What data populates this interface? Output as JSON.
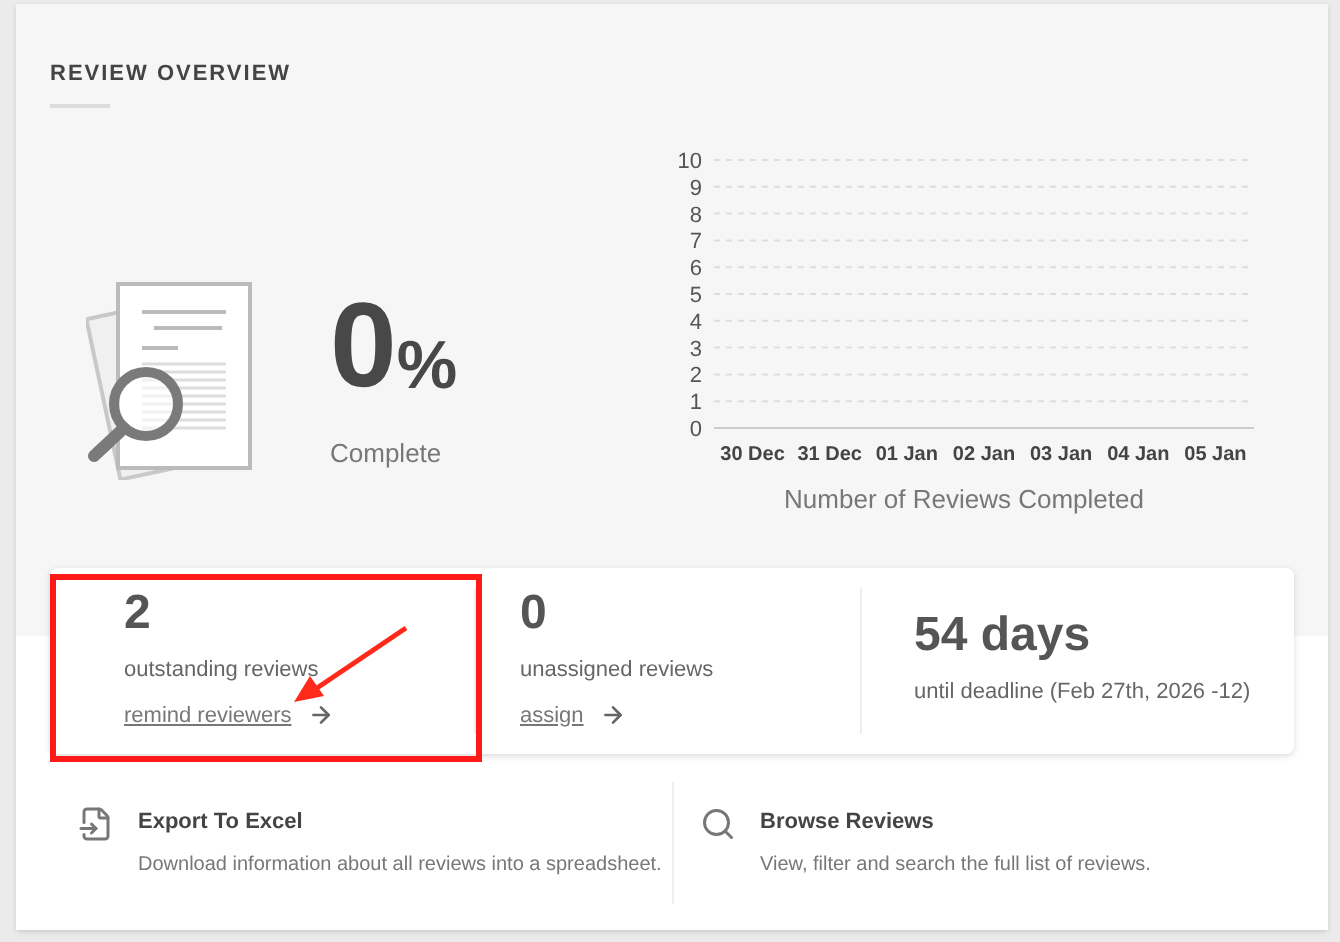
{
  "section_title": "REVIEW OVERVIEW",
  "progress": {
    "value": "0",
    "unit": "%",
    "label": "Complete"
  },
  "chart": {
    "chart_data": {
      "type": "bar",
      "xlabel": "Number of Reviews Completed",
      "categories": [
        "30 Dec",
        "31 Dec",
        "01 Jan",
        "02 Jan",
        "03 Jan",
        "04 Jan",
        "05 Jan"
      ],
      "ylim": [
        0,
        10
      ],
      "grid": true,
      "yticks": [
        0,
        1,
        2,
        3,
        4,
        5,
        6,
        7,
        8,
        9,
        10
      ]
    }
  },
  "stats": [
    {
      "value": "2",
      "label": "outstanding reviews",
      "link": "remind reviewers",
      "highlighted": true
    },
    {
      "value": "0",
      "label": "unassigned reviews",
      "link": "assign",
      "highlighted": false
    },
    {
      "value": "54 days",
      "label": "until deadline (Feb 27th, 2026 -12)",
      "highlighted": false
    }
  ],
  "actions": [
    {
      "kind": "export",
      "title": "Export To Excel",
      "description": "Download information about all reviews into a spreadsheet."
    },
    {
      "kind": "browse",
      "title": "Browse Reviews",
      "description": "View, filter and search the full list of reviews."
    }
  ]
}
